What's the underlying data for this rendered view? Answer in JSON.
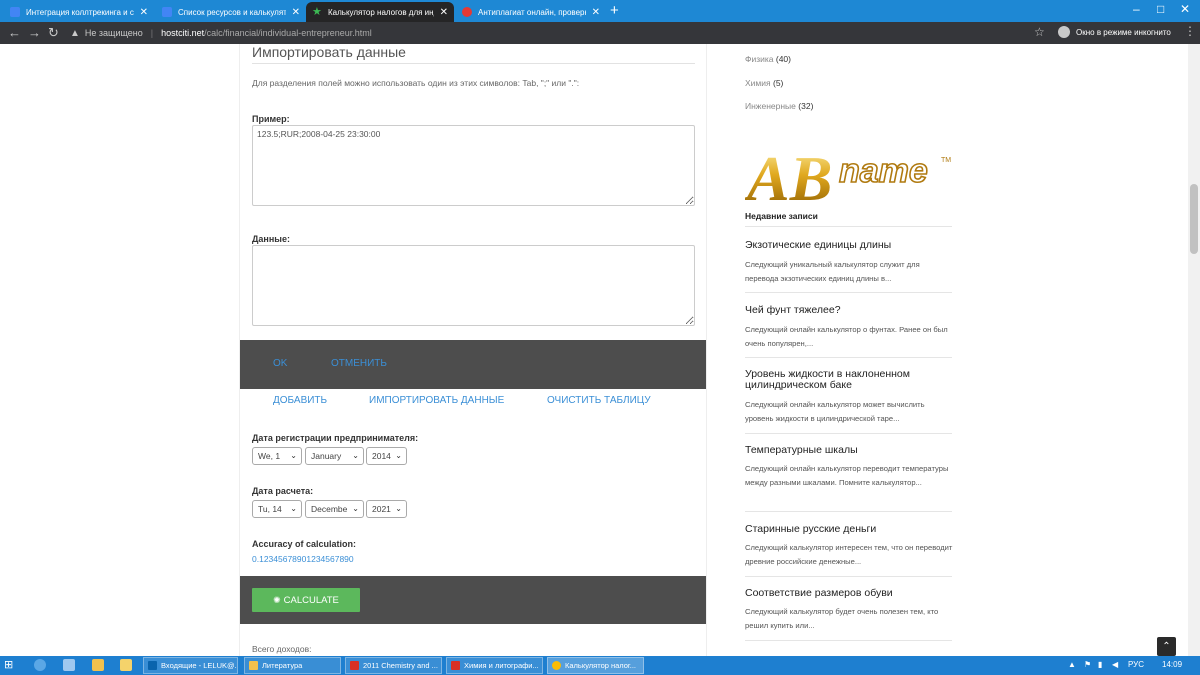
{
  "browser": {
    "tabs": [
      {
        "title": "Интеграция коллтрекинга и ско",
        "icon": "docs-icon",
        "color": "#4285f4"
      },
      {
        "title": "Список ресурсов и калькулятор",
        "icon": "docs-icon",
        "color": "#4285f4"
      },
      {
        "title": "Калькулятор налогов для индив",
        "icon": "star-favicon",
        "color": "#3cba54"
      },
      {
        "title": "Антиплагиат онлайн, проверка",
        "icon": "antiplagiat-icon",
        "color": "#e53935"
      }
    ],
    "new_tab": "+",
    "win_controls": [
      "–",
      "□",
      "✕"
    ],
    "nav": {
      "back": "←",
      "forward": "→",
      "reload": "↻"
    },
    "security": "Не защищено",
    "url_host": "hostciti.net",
    "url_path": "/calc/financial/individual-entrepreneur.html",
    "incognito_label": "Окно в режиме инкогнито"
  },
  "import": {
    "heading": "Импортировать данные",
    "hint": "Для разделения полей можно использовать один из этих символов: Tab, \";\" или \".\":",
    "example_label": "Пример:",
    "example_value": "123.5;RUR;2008-04-25 23:30:00",
    "data_label": "Данные:",
    "data_value": "",
    "ok": "OK",
    "cancel": "ОТМЕНИТЬ"
  },
  "actions": {
    "add": "ДОБАВИТЬ",
    "import": "ИМПОРТИРОВАТЬ ДАННЫЕ",
    "clear": "ОЧИСТИТЬ ТАБЛИЦУ"
  },
  "form": {
    "reg_label": "Дата регистрации предпринимателя:",
    "reg_day": "We, 1",
    "reg_month": "January",
    "reg_year": "2014",
    "calc_label": "Дата расчета:",
    "calc_day": "Tu, 14",
    "calc_month": "Decembe",
    "calc_year": "2021",
    "accuracy_label": "Accuracy of calculation:",
    "accuracy_value": "0.12345678901234567890",
    "calculate": "CALCULATE",
    "total_label": "Всего доходов:"
  },
  "sidebar": {
    "categories": [
      {
        "name": "Физика",
        "count": "(40)"
      },
      {
        "name": "Химия",
        "count": "(5)"
      },
      {
        "name": "Инженерные",
        "count": "(32)"
      }
    ],
    "logo_text": "ABCname",
    "recent_heading": "Недавние записи",
    "posts": [
      {
        "title": "Экзотические единицы длины",
        "excerpt": "Следующий уникальный калькулятор служит для перевода экзотических единиц длины в..."
      },
      {
        "title": "Чей фунт тяжелее?",
        "excerpt": "Следующий онлайн калькулятор о фунтах. Ранее он был очень популярен,..."
      },
      {
        "title": "Уровень жидкости в наклоненном цилиндрическом баке",
        "excerpt": "Следующий онлайн калькулятор может вычислить уровень жидкости в цилиндрической таре..."
      },
      {
        "title": "Температурные шкалы",
        "excerpt": "Следующий онлайн калькулятор переводит температуры между разными шкалами. Помните калькулятор..."
      },
      {
        "title": "Старинные русские деньги",
        "excerpt": "Следующий калькулятор интересен тем, что он переводит древние российские денежные..."
      },
      {
        "title": "Соответствие размеров обуви",
        "excerpt": "Следующий калькулятор будет очень полезен тем, кто решил купить или..."
      }
    ]
  },
  "taskbar": {
    "items": [
      {
        "label": "Входящие - LELUK@...",
        "icon": "outlook-icon",
        "color": "#0a64ad"
      },
      {
        "label": "Литература",
        "icon": "folder-icon",
        "color": "#f2c14e"
      },
      {
        "label": "2011 Chemistry and ...",
        "icon": "pdf-icon",
        "color": "#d93025"
      },
      {
        "label": "Химия и литографи...",
        "icon": "pdf-icon",
        "color": "#d93025"
      },
      {
        "label": "Калькулятор налог...",
        "icon": "chrome-icon",
        "color": "#fbbc05"
      }
    ],
    "lang": "РУС",
    "time": "14:09"
  }
}
